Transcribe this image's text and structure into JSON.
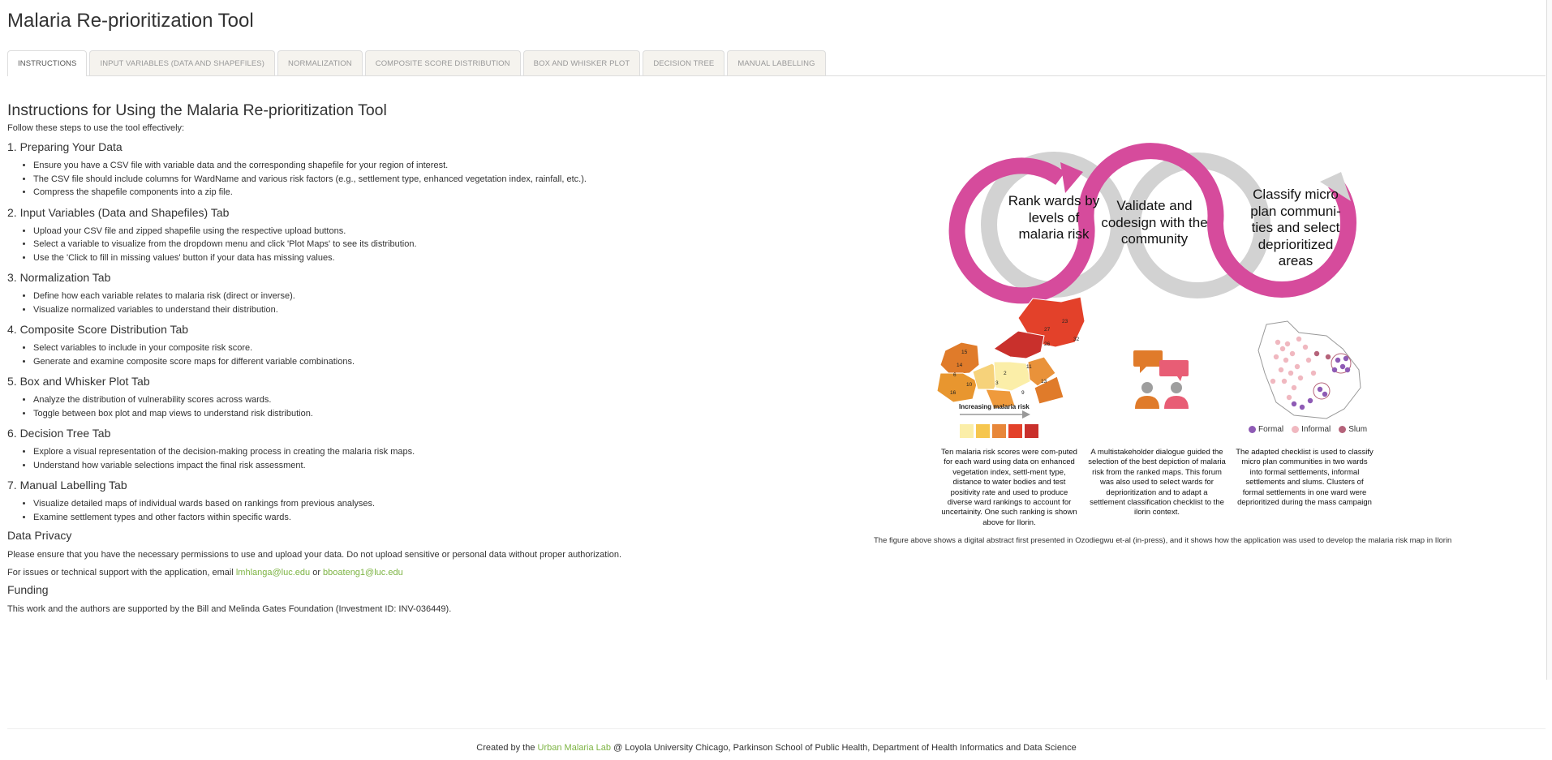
{
  "app": {
    "title": "Malaria Re-prioritization Tool"
  },
  "tabs": [
    {
      "label": "INSTRUCTIONS"
    },
    {
      "label": "INPUT VARIABLES (DATA AND SHAPEFILES)"
    },
    {
      "label": "NORMALIZATION"
    },
    {
      "label": "COMPOSITE SCORE DISTRIBUTION"
    },
    {
      "label": "BOX AND WHISKER PLOT"
    },
    {
      "label": "DECISION TREE"
    },
    {
      "label": "MANUAL LABELLING"
    }
  ],
  "active_tab": "INSTRUCTIONS",
  "instructions": {
    "heading": "Instructions for Using the Malaria Re-prioritization Tool",
    "intro": "Follow these steps to use the tool effectively:",
    "steps": [
      {
        "title": "1. Preparing Your Data",
        "items": [
          "Ensure you have a CSV file with variable data and the corresponding shapefile for your region of interest.",
          "The CSV file should include columns for WardName and various risk factors (e.g., settlement type, enhanced vegetation index, rainfall, etc.).",
          "Compress the shapefile components into a zip file."
        ]
      },
      {
        "title": "2. Input Variables (Data and Shapefiles) Tab",
        "items": [
          "Upload your CSV file and zipped shapefile using the respective upload buttons.",
          "Select a variable to visualize from the dropdown menu and click 'Plot Maps' to see its distribution.",
          "Use the 'Click to fill in missing values' button if your data has missing values."
        ]
      },
      {
        "title": "3. Normalization Tab",
        "items": [
          "Define how each variable relates to malaria risk (direct or inverse).",
          "Visualize normalized variables to understand their distribution."
        ]
      },
      {
        "title": "4. Composite Score Distribution Tab",
        "items": [
          "Select variables to include in your composite risk score.",
          "Generate and examine composite score maps for different variable combinations."
        ]
      },
      {
        "title": "5. Box and Whisker Plot Tab",
        "items": [
          "Analyze the distribution of vulnerability scores across wards.",
          "Toggle between box plot and map views to understand risk distribution."
        ]
      },
      {
        "title": "6. Decision Tree Tab",
        "items": [
          "Explore a visual representation of the decision-making process in creating the malaria risk maps.",
          "Understand how variable selections impact the final risk assessment."
        ]
      },
      {
        "title": "7. Manual Labelling Tab",
        "items": [
          "Visualize detailed maps of individual wards based on rankings from previous analyses.",
          "Examine settlement types and other factors within specific wards."
        ]
      }
    ],
    "privacy_heading": "Data Privacy",
    "privacy_text": "Please ensure that you have the necessary permissions to use and upload your data. Do not upload sensitive or personal data without proper authorization.",
    "support_prefix": "For issues or technical support with the application, email ",
    "support_email1": "lmhlanga@luc.edu",
    "support_or": " or ",
    "support_email2": "bboateng1@luc.edu",
    "funding_heading": "Funding",
    "funding_text": "This work and the authors are supported by the Bill and Melinda Gates Foundation (Investment ID: INV-036449)."
  },
  "figure": {
    "bubble1": "Rank wards by levels of malaria risk",
    "bubble2": "Validate and codesign with the community",
    "bubble3": "Classify micro plan communi-ties and select deprioritized areas",
    "risk_caption": "Increasing malaria risk",
    "legend": [
      {
        "label": "Formal",
        "color": "#8e5bb5"
      },
      {
        "label": "Informal",
        "color": "#f0b8c0"
      },
      {
        "label": "Slum",
        "color": "#b5637a"
      }
    ],
    "ward_numbers": [
      "23",
      "27",
      "32",
      "26",
      "15",
      "11",
      "14",
      "6",
      "2",
      "13",
      "10",
      "3",
      "9",
      "16"
    ],
    "col1_text": "Ten malaria risk scores were com-puted for each ward using data on enhanced vegetation index, settl-ment type, distance to water bodies and test positivity rate and used to produce diverse ward rankings to account for uncertainity. One such ranking is shown above for Ilorin.",
    "col2_text": "A multistakeholder dialogue guided the selection of the best depiction of malaria risk from the ranked maps. This forum was also used to select wards for deprioritization and to adapt a settlement classification checklist to the ilorin context.",
    "col3_text": "The adapted checklist is used to classify micro plan communities in two wards into formal settlements, informal settlements and slums. Clusters of formal settlements in one ward were deprioritized during the mass campaign",
    "caption": "The figure above shows a digital abstract first presented in Ozodiegwu et-al (in-press), and it shows how the application was used to develop the malaria risk map in Ilorin",
    "colors": {
      "magenta": "#d64b9c",
      "grey": "#d2d2d2",
      "orange": "#e07b2a",
      "pink": "#e85d75",
      "person": "#9e9e9e"
    }
  },
  "footer": {
    "prefix": "Created by the ",
    "link": "Urban Malaria Lab",
    "suffix": " @ Loyola University Chicago, Parkinson School of Public Health, Department of Health Informatics and Data Science"
  }
}
